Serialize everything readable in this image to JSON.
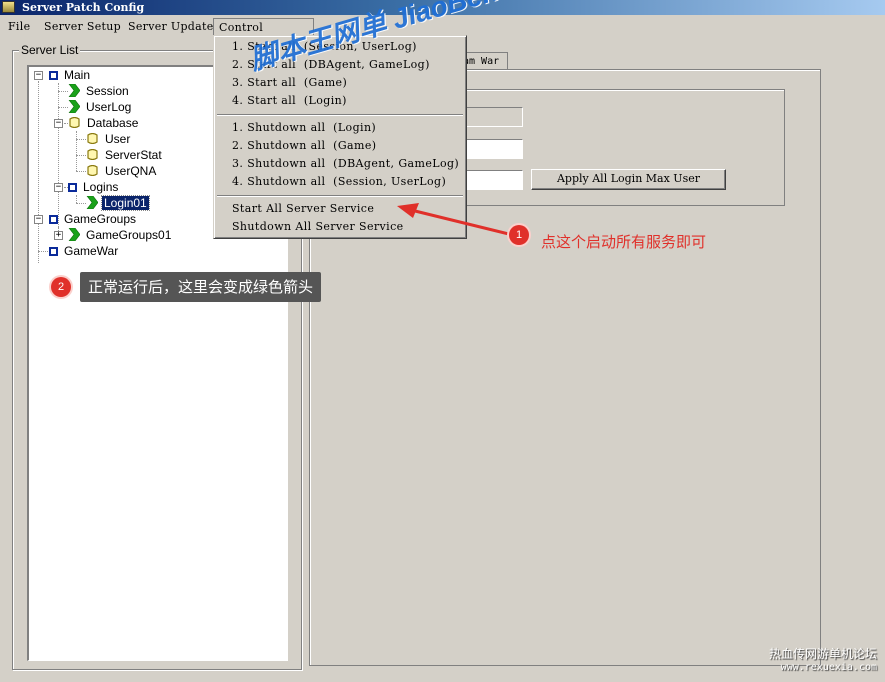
{
  "window": {
    "title": "Server Patch Config"
  },
  "menubar": {
    "items": [
      "File",
      "Server Setup",
      "Server Update",
      "Control Service"
    ]
  },
  "server_list": {
    "label": "Server List",
    "nodes": [
      {
        "label": "Main",
        "icon": "square-icon"
      },
      {
        "label": "Session",
        "icon": "green-arrow-icon"
      },
      {
        "label": "UserLog",
        "icon": "green-arrow-icon"
      },
      {
        "label": "Database",
        "icon": "database-icon"
      },
      {
        "label": "User",
        "icon": "database-icon"
      },
      {
        "label": "ServerStat",
        "icon": "database-icon"
      },
      {
        "label": "UserQNA",
        "icon": "database-icon"
      },
      {
        "label": "Logins",
        "icon": "square-icon"
      },
      {
        "label": "Login01",
        "icon": "green-arrow-icon",
        "selected": true
      },
      {
        "label": "GameGroups",
        "icon": "square-icon"
      },
      {
        "label": "GameGroups01",
        "icon": "green-arrow-icon"
      },
      {
        "label": "GameWar",
        "icon": "square-icon"
      }
    ]
  },
  "control_menu": {
    "start_items": [
      "1. Start all  (Session, UserLog)",
      "2. Start all  (DBAgent, GameLog)",
      "3. Start all  (Game)",
      "4. Start all  (Login)"
    ],
    "shutdown_items": [
      "1. Shutdown all  (Login)",
      "2. Shutdown all  (Game)",
      "3. Shutdown all  (DBAgent, GameLog)",
      "4. Shutdown all  (Session, UserLog)"
    ],
    "start_all_service": "Start All Server Service",
    "shutdown_all_service": "Shutdown All Server Service"
  },
  "right_panel": {
    "tab_label": "am War",
    "apply_button": "Apply All Login Max User"
  },
  "annotations": {
    "watermark": "脚本王网单 JiaoBenWang.Com",
    "badge1": "1",
    "badge2": "2",
    "note1": "点这个启动所有服务即可",
    "note2": "正常运行后，这里会变成绿色箭头",
    "site_line1": "热血传网游单机论坛",
    "site_line2": "www.rexuexia.com"
  },
  "colors": {
    "accent_red": "#e0302a",
    "arrow_green": "#1aa11a",
    "tree_blue": "#0a2a9a",
    "selection": "#0a246a"
  }
}
